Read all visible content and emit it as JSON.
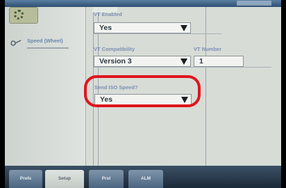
{
  "topbar": {
    "status": ""
  },
  "sidebar": {
    "speed": {
      "label": "Speed (Wheel)"
    }
  },
  "fields": {
    "vt_enabled": {
      "label": "VT Enabled",
      "value": "Yes"
    },
    "vt_compatibility": {
      "label": "VT Compatibility",
      "value": "Version 3"
    },
    "vt_number": {
      "label": "VT Number",
      "value": "1"
    },
    "send_iso_speed": {
      "label": "Send ISO Speed?",
      "value": "Yes"
    }
  },
  "tabs": [
    {
      "label": "Prefs"
    },
    {
      "label": "Setup"
    },
    {
      "label": "Prst"
    },
    {
      "label": "ALM"
    }
  ],
  "colors": {
    "highlight": "#e0151d",
    "label_blue": "#7b8fb5"
  }
}
